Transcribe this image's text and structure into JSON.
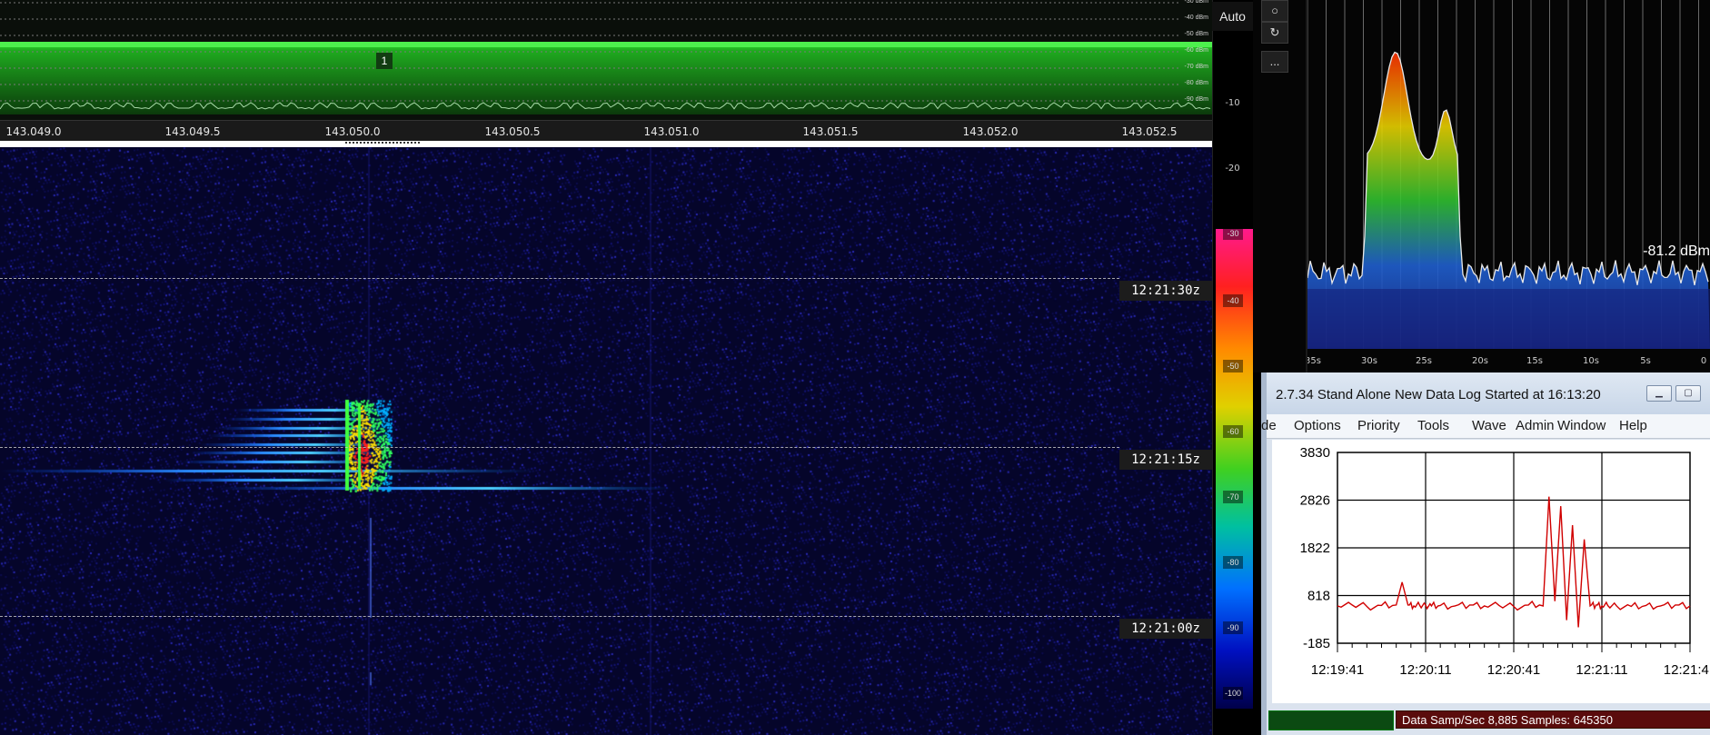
{
  "spectrum": {
    "dbm_labels": [
      "-30 dBm",
      "-40 dBm",
      "-50 dBm",
      "-60 dBm",
      "-70 dBm",
      "-80 dBm",
      "-90 dBm"
    ],
    "marker_label": "1",
    "freq_ticks": [
      "143.049.0",
      "143.049.5",
      "143.050.0",
      "143.050.5",
      "143.051.0",
      "143.051.5",
      "143.052.0",
      "143.052.5"
    ]
  },
  "waterfall": {
    "time_labels": [
      "12:21:30z",
      "12:21:15z",
      "12:21:00z"
    ]
  },
  "scale": {
    "auto_label": "Auto",
    "ticks": [
      "-10",
      "-20",
      "-30",
      "-40",
      "-50",
      "-60",
      "-70",
      "-80",
      "-90",
      "-100"
    ]
  },
  "tools": {
    "btn1": "○",
    "btn2": "↻",
    "btn3": "..."
  },
  "scope": {
    "level_readout": "-81.2 dBm",
    "x_ticks": [
      "35s",
      "30s",
      "25s",
      "20s",
      "15s",
      "10s",
      "5s",
      "0"
    ]
  },
  "logger": {
    "title": "2.7.34  Stand Alone   New Data Log Started at 16:13:20",
    "menu": [
      "de",
      "Options",
      "Priority",
      "Tools",
      "Wave",
      "Admin",
      "Window",
      "Help"
    ],
    "status_left": "",
    "status_text": "Data Samp/Sec 8,885   Samples:  645350"
  },
  "chart_data": {
    "type": "line",
    "title": "",
    "xlabel": "",
    "ylabel": "",
    "y_ticks": [
      "3830",
      "2826",
      "1822",
      "818",
      "-185"
    ],
    "x_ticks": [
      "12:19:41",
      "12:20:11",
      "12:20:41",
      "12:21:11",
      "12:21:41"
    ],
    "ylim": [
      -185,
      3830
    ],
    "grid": true,
    "color": "#d00000",
    "series": [
      {
        "x": [
          0,
          5,
          10,
          15,
          20,
          22,
          24,
          26,
          28,
          30,
          32,
          35,
          40,
          45,
          50,
          55,
          60,
          65,
          70,
          72,
          74,
          76,
          78,
          80,
          82,
          84,
          86,
          88,
          90,
          92,
          95,
          100,
          105,
          110,
          115,
          120
        ],
        "values": [
          600,
          620,
          590,
          610,
          620,
          1100,
          620,
          600,
          610,
          620,
          600,
          610,
          600,
          620,
          600,
          610,
          590,
          620,
          600,
          2900,
          700,
          2700,
          300,
          2300,
          150,
          2000,
          600,
          620,
          600,
          610,
          600,
          590,
          610,
          600,
          620,
          600
        ]
      }
    ],
    "axis_x_seconds_span": 120
  },
  "colors": {
    "waterfall_bg": "#0a0a3c",
    "spectrum_green": "#00cc00",
    "scope_trace": "#e8e8e8",
    "logger_trace": "#d00000",
    "status_left_bg": "#0b4a12",
    "status_right_bg": "#5a0c0c"
  }
}
